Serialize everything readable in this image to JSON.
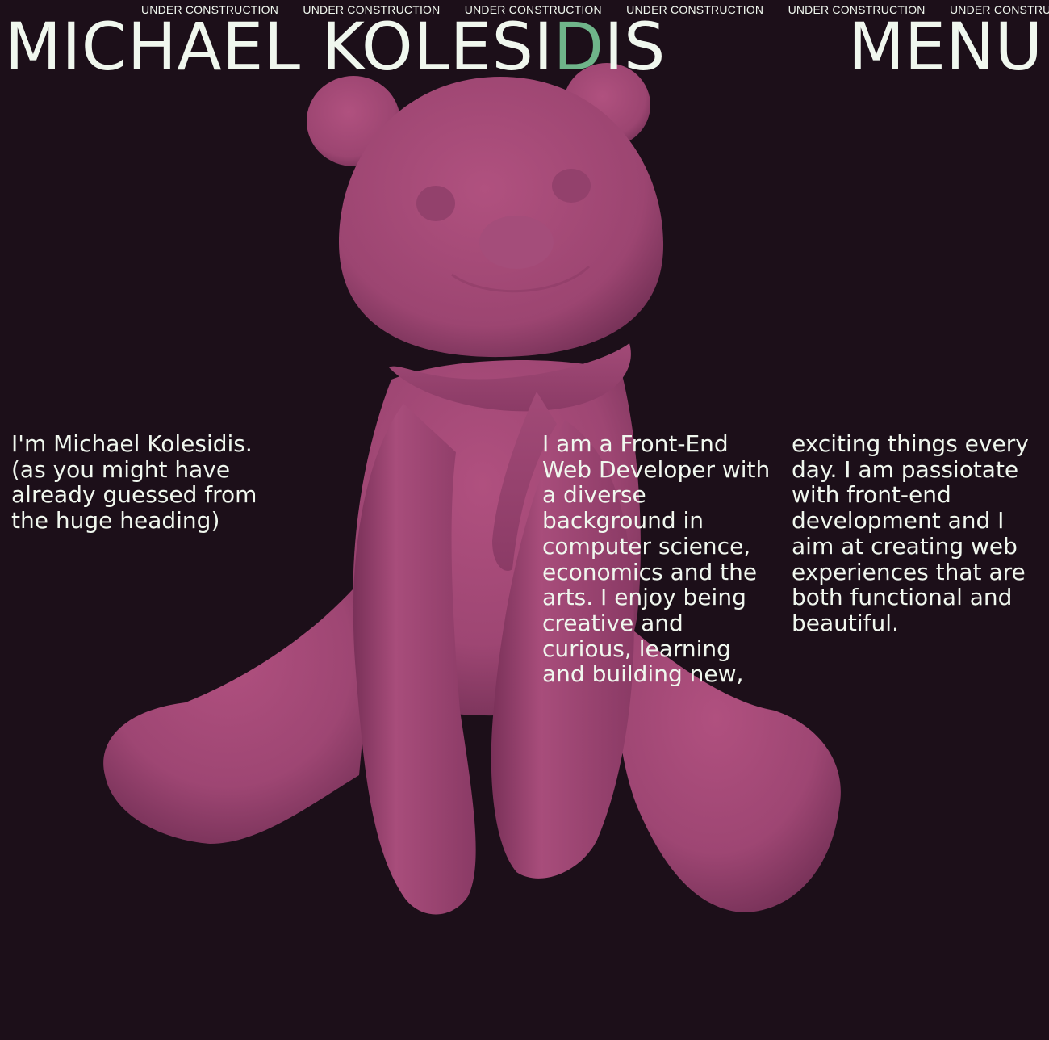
{
  "ticker": {
    "items": [
      "UNDER CONSTRUCTION",
      "UNDER CONSTRUCTION",
      "UNDER CONSTRUCTION",
      "UNDER CONSTRUCTION",
      "UNDER CONSTRUCTION",
      "UNDER CONSTRUCTION"
    ]
  },
  "header": {
    "brand_before": "MICHAEL KOLESI",
    "brand_accent": "D",
    "brand_after": "IS",
    "menu_label": "MENU"
  },
  "hero": {
    "image_label": "pink teddy bear with scarf 3D model",
    "colors": {
      "background": "#1c0f19",
      "text": "#f0f7ee",
      "accent": "#6fb58a",
      "bear": "#a24a77"
    }
  },
  "about": {
    "intro": "I'm Michael Kolesidis. (as you might have already guessed from the huge heading)",
    "col_mid": "I am a Front-End Web Developer with a diverse background in computer science, economics and the arts. I enjoy being creative and curious, learning and building new,",
    "col_right": "exciting things every day. I am passiotate with front-end development and I aim at creating web experiences that are both functional and beautiful."
  }
}
